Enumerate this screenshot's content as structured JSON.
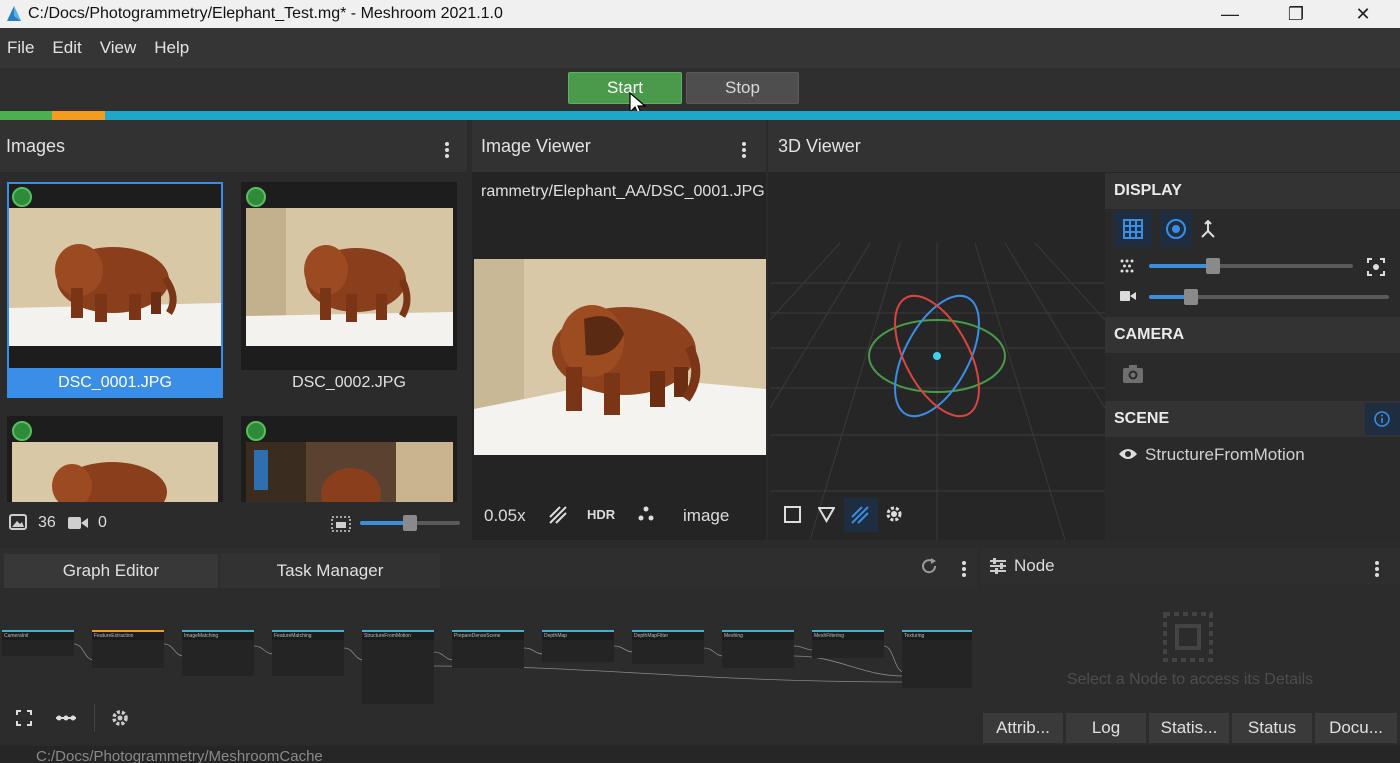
{
  "window": {
    "title": "C:/Docs/Photogrammetry/Elephant_Test.mg* - Meshroom 2021.1.0",
    "controls": [
      "minimize-icon",
      "restore-icon",
      "close-icon"
    ]
  },
  "menu": [
    "File",
    "Edit",
    "View",
    "Help"
  ],
  "toolbar": {
    "start_label": "Start",
    "stop_label": "Stop"
  },
  "colors": {
    "start": "#4b9a4c",
    "progress": "#1fa7c8",
    "progress_done": "#4caf50",
    "progress_running": "#f39c1e",
    "selection": "#3a8ee6"
  },
  "images_panel": {
    "title": "Images",
    "thumbnails": [
      {
        "label": "DSC_0001.JPG",
        "selected": true
      },
      {
        "label": "DSC_0002.JPG",
        "selected": false
      },
      {
        "label": "",
        "selected": false
      },
      {
        "label": "",
        "selected": false
      }
    ],
    "image_count": "36",
    "camera_count": "0",
    "thumb_size_level": 0.5
  },
  "image_viewer": {
    "title": "Image Viewer",
    "path": "rammetry/Elephant_AA/DSC_0001.JPG",
    "zoom": "0.05x",
    "hdr_label": "HDR",
    "channel": "image"
  },
  "viewer3d": {
    "title": "3D Viewer",
    "display_header": "DISPLAY",
    "camera_header": "CAMERA",
    "scene_header": "SCENE",
    "scene_items": [
      "StructureFromMotion"
    ],
    "point_size_level": 0.3,
    "camera_scale_level": 0.18
  },
  "graph_editor": {
    "tabs": [
      "Graph Editor",
      "Task Manager"
    ],
    "nodes": [
      "CameraInit",
      "FeatureExtraction",
      "ImageMatching",
      "FeatureMatching",
      "StructureFromMotion",
      "PrepareDenseScene",
      "DepthMap",
      "DepthMapFilter",
      "Meshing",
      "MeshFiltering",
      "Texturing"
    ]
  },
  "node_panel": {
    "title": "Node",
    "placeholder": "Select a Node to access its Details",
    "tabs": [
      "Attrib...",
      "Log",
      "Statis...",
      "Status",
      "Docu..."
    ]
  },
  "status": {
    "cache_path": "C:/Docs/Photogrammetry/MeshroomCache"
  }
}
